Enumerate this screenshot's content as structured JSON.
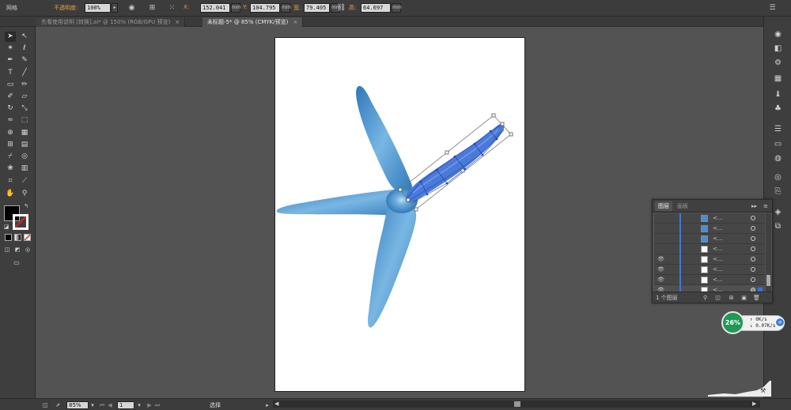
{
  "control_bar": {
    "mode_label": "网格",
    "opacity_label": "不透明度:",
    "opacity_value": "100%",
    "x_label": "X:",
    "x_value": "152.041",
    "y_label": "Y:",
    "y_value": "104.795",
    "w_label": "宽:",
    "w_value": "79.405",
    "h_label": "高:",
    "h_value": "64.697",
    "unit": "mm"
  },
  "tabs": [
    {
      "label": "先看使用说明 [转换].ai* @ 150% (RGB/GPU 预览)",
      "close": "×"
    },
    {
      "label": "未标题-5* @ 85% (CMYK/预览)",
      "close": "×"
    }
  ],
  "layers_panel": {
    "tab_layers": "图层",
    "tab_artboards": "画板",
    "menu": "≡",
    "collapse": "▸▸",
    "rows": [
      {
        "name": "<...",
        "visible": false
      },
      {
        "name": "<...",
        "visible": false
      },
      {
        "name": "<...",
        "visible": false
      },
      {
        "name": "<...",
        "visible": false
      },
      {
        "name": "<...",
        "visible": true
      },
      {
        "name": "<...",
        "visible": true
      },
      {
        "name": "<...",
        "visible": true
      },
      {
        "name": "<...",
        "visible": true
      }
    ],
    "footer_count": "1 个图层"
  },
  "network_widget": {
    "percent": "26%",
    "upload": "0K/s",
    "download": "0.07K/s"
  },
  "status_bar": {
    "zoom": "85%",
    "page": "1",
    "tool_status": "选择"
  },
  "colors": {
    "starfish": "#3f8cc8",
    "starfish_light": "#a9d0ec",
    "selection": "#3b5bdb",
    "accent_orange": "#e8a24a"
  }
}
